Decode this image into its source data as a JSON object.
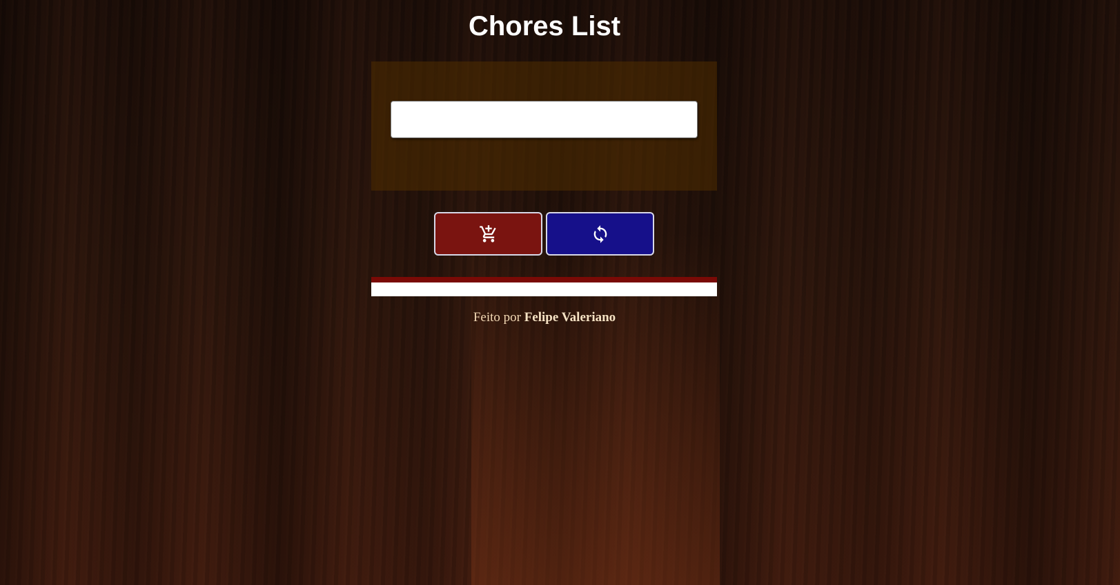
{
  "page": {
    "title": "Chores List"
  },
  "form": {
    "input_value": "",
    "input_placeholder": ""
  },
  "buttons": {
    "add": {
      "icon": "cart-plus-icon",
      "color": "#7a1410"
    },
    "refresh": {
      "icon": "refresh-icon",
      "color": "#16108a"
    }
  },
  "footer": {
    "prefix": "Feito por",
    "author": "Felipe Valeriano"
  },
  "colors": {
    "list_bar_accent": "#7a0a06",
    "panel": "#502d00",
    "title_text": "#ffffff",
    "footer_text": "#f2d8b4"
  }
}
